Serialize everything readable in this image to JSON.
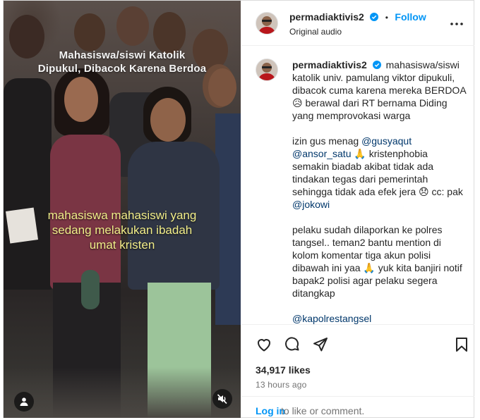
{
  "post": {
    "username": "permadiaktivis2",
    "verified": true,
    "follow_label": "Follow",
    "separator": "•",
    "audio": "Original audio",
    "more_icon": "more-horizontal-icon"
  },
  "media": {
    "title_lines": [
      "Mahasiswa/siswi  Katolik",
      "Dipukul, Dibacok Karena Berdoa"
    ],
    "caption_lines": [
      "mahasiswa mahasiswi yang",
      "sedang melakukan ibadah",
      "umat kristen"
    ],
    "account_icon": "user-icon",
    "mute_icon": "speaker-muted-icon"
  },
  "caption": {
    "username": "permadiaktivis2",
    "p1": {
      "text": "mahasiswa/siswi katolik univ. pamulang viktor dipukuli, dibacok cuma karena mereka BERDOA 😥 berawal dari RT bernama Diding yang memprovokasi warga"
    },
    "p2": {
      "pre": "izin gus menag ",
      "m1": "@gusyaqut",
      "m2": "@ansor_satu",
      "mid": " 🙏 kristenphobia semakin biadab akibat tidak ada tindakan tegas dari pemerintah sehingga tidak ada efek jera 😞 cc: pak ",
      "m3": "@jokowi"
    },
    "p3": {
      "text": "pelaku sudah dilaporkan ke polres tangsel.. teman2 bantu mention di kolom komentar tiga akun polisi dibawah ini yaa 🙏 yuk kita banjiri notif bapak2 polisi agar pelaku segera ditangkap"
    },
    "p4": {
      "mention": "@kapolrestangsel"
    }
  },
  "actions": {
    "like_icon": "heart-icon",
    "comment_icon": "comment-icon",
    "share_icon": "share-icon",
    "save_icon": "bookmark-icon",
    "likes": "34,917 likes",
    "time": "13 hours ago",
    "login_link": "Log in",
    "login_rest": " to like or comment."
  }
}
